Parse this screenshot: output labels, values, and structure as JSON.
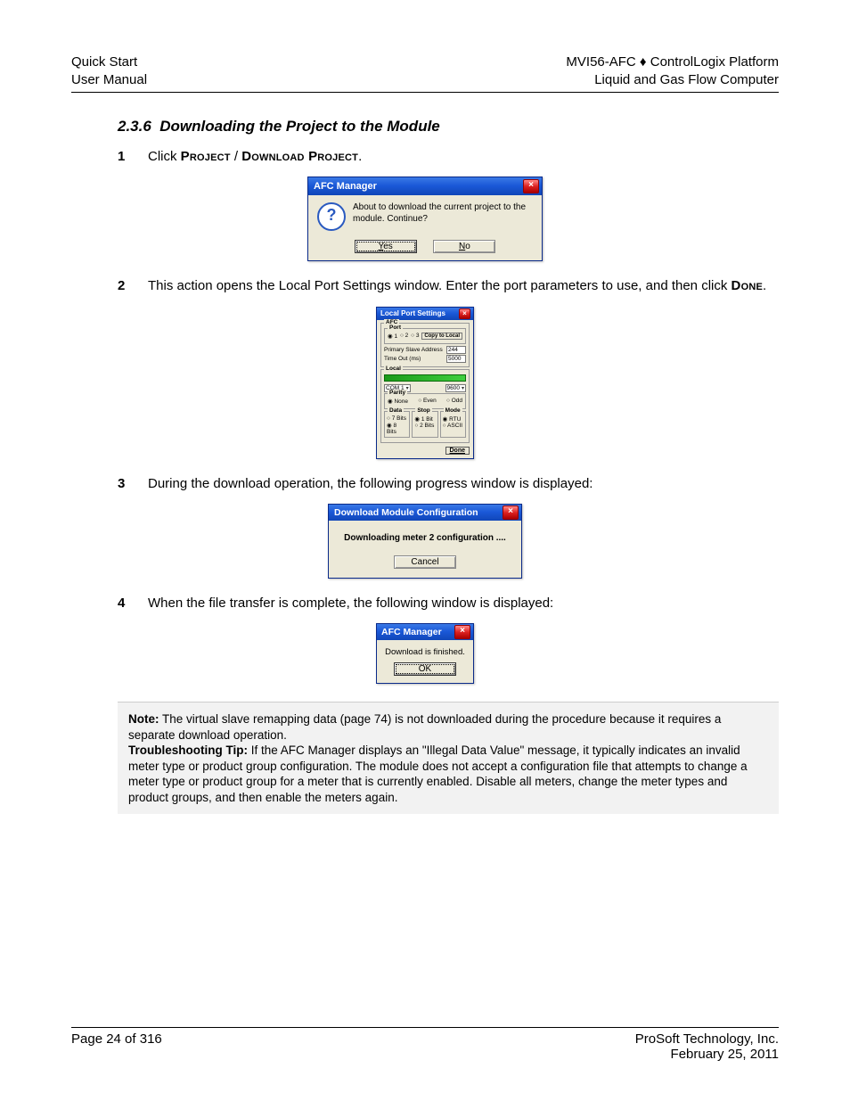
{
  "header": {
    "left_line1": "Quick Start",
    "left_line2": "User Manual",
    "right_line1": "MVI56-AFC ♦ ControlLogix Platform",
    "right_line2": "Liquid and Gas Flow Computer"
  },
  "section": {
    "number": "2.3.6",
    "title": "Downloading the Project to the Module"
  },
  "steps": [
    {
      "num": "1",
      "pre": "Click ",
      "sc1": "Project",
      "mid": " / ",
      "sc2": "Download Project",
      "post": "."
    },
    {
      "num": "2",
      "text_a": "This action opens the Local Port Settings window. Enter the port parameters to use, and then click ",
      "sc": "Done",
      "text_b": "."
    },
    {
      "num": "3",
      "text": "During the download operation, the following progress window is displayed:"
    },
    {
      "num": "4",
      "text": "When the file transfer is complete, the following window is displayed:"
    }
  ],
  "dialog1": {
    "title": "AFC Manager",
    "close": "×",
    "icon_text": "?",
    "message": "About to download the current project to the module. Continue?",
    "yes_hot": "Y",
    "yes_rest": "es",
    "no_hot": "N",
    "no_rest": "o"
  },
  "dialog2": {
    "title": "Local Port Settings",
    "close": "×",
    "afc_legend": "AFC",
    "port_legend": "Port",
    "port_opts": [
      "1",
      "2",
      "3"
    ],
    "copy_btn": "Copy to Local",
    "primary_slave_label": "Primary Slave Address",
    "primary_slave_val": "244",
    "timeout_label": "Time Out (ms)",
    "timeout_val": "5000",
    "local_legend": "Local",
    "com_val": "COM 1",
    "baud_val": "9600",
    "parity_legend": "Parity",
    "parity_opts": [
      "None",
      "Even",
      "Odd"
    ],
    "data_legend": "Data",
    "data_opts": [
      "7 Bits",
      "8 Bits"
    ],
    "stop_legend": "Stop",
    "stop_opts": [
      "1 Bit",
      "2 Bits"
    ],
    "mode_legend": "Mode",
    "mode_opts": [
      "RTU",
      "ASCII"
    ],
    "done": "Done"
  },
  "dialog3": {
    "title": "Download Module Configuration",
    "close": "×",
    "message": "Downloading meter 2 configuration ....",
    "cancel": "Cancel"
  },
  "dialog4": {
    "title": "AFC Manager",
    "close": "×",
    "message": "Download is finished.",
    "ok": "OK"
  },
  "note": {
    "note_label": "Note:",
    "note_text": " The virtual slave remapping data (page 74) is not downloaded during the procedure because it requires a separate download operation.",
    "tip_label": "Troubleshooting Tip:",
    "tip_text": " If the AFC Manager displays an \"Illegal Data Value\" message, it typically indicates an invalid meter type or product group configuration. The module does not accept a configuration file that attempts to change a meter type or product group for a meter that is currently enabled. Disable all meters, change the meter types and product groups, and then enable the meters again."
  },
  "footer": {
    "left": "Page 24 of 316",
    "right_line1": "ProSoft Technology, Inc.",
    "right_line2": "February 25, 2011"
  }
}
